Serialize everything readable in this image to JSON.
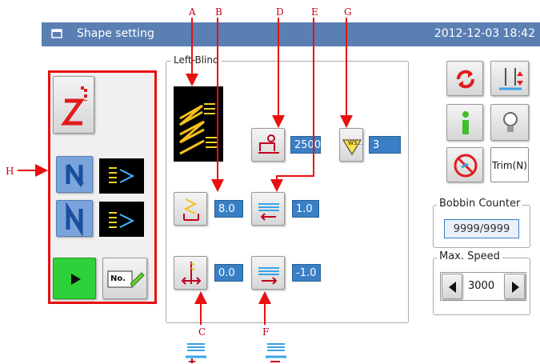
{
  "window": {
    "title": "Shape setting",
    "datetime": "2012-12-03 18:42"
  },
  "group": {
    "legend": "Left-Blind"
  },
  "values": {
    "speed_adjust": "2500",
    "g_value": "3",
    "b_value": "8.0",
    "e_value": "1.0",
    "c_value": "0.0",
    "f_value": "-1.0"
  },
  "right_panel": {
    "trim_label": "Trim(N)",
    "bobbin_counter_label": "Bobbin Counter",
    "bobbin_counter_value": "9999/9999",
    "max_speed_label": "Max. Speed",
    "max_speed_value": "3000"
  },
  "annotations": {
    "a": "A",
    "b": "B",
    "c": "C",
    "d": "D",
    "e": "E",
    "f": "F",
    "g": "G",
    "h": "H"
  },
  "g_button_badge": "W3...",
  "left_panel": {
    "program_button_badge": "No."
  },
  "colors": {
    "title_bar": "#5a7fb3",
    "annotation": "#c0001f",
    "value_box": "#3a7fc6",
    "highlight_frame": "#e81010"
  }
}
